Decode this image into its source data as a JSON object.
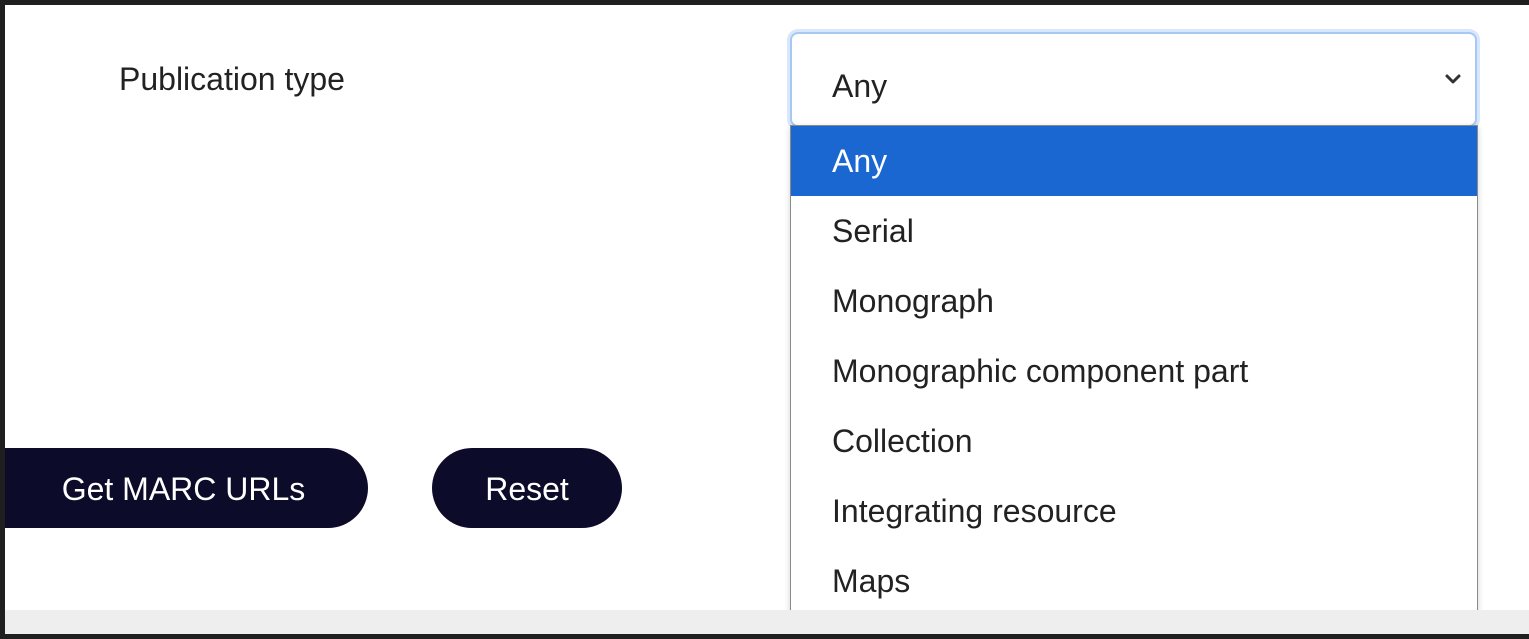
{
  "form": {
    "publication_type_label": "Publication type",
    "select": {
      "value": "Any",
      "focus_color": "#a6c8f2"
    },
    "options": [
      {
        "label": "Any",
        "selected": true
      },
      {
        "label": "Serial",
        "selected": false
      },
      {
        "label": "Monograph",
        "selected": false
      },
      {
        "label": "Monographic component part",
        "selected": false
      },
      {
        "label": "Collection",
        "selected": false
      },
      {
        "label": "Integrating resource",
        "selected": false
      },
      {
        "label": "Maps",
        "selected": false
      }
    ],
    "highlight_color": "#1a67d2"
  },
  "buttons": {
    "get_marc_urls": "Get MARC URLs",
    "reset": "Reset",
    "color": "#0c0c2a"
  },
  "icons": {
    "select_chevron": "chevron-down-icon"
  }
}
